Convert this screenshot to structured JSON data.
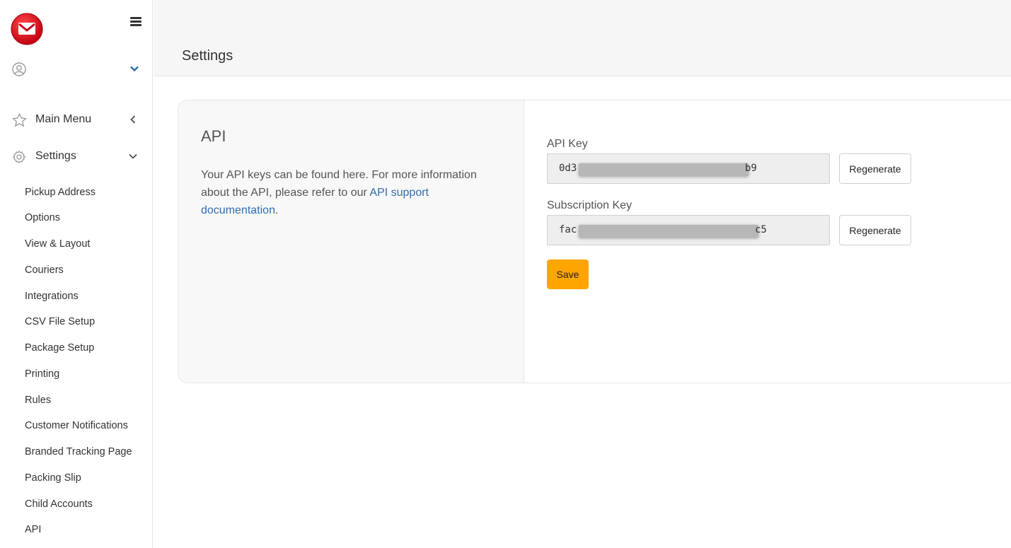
{
  "colors": {
    "accent": "#ffa500",
    "link": "#2f6db3",
    "brand": "#d9001b"
  },
  "sidebar": {
    "logo_icon": "envelope-logo",
    "main_menu_label": "Main Menu",
    "settings_label": "Settings",
    "items": [
      "Pickup Address",
      "Options",
      "View & Layout",
      "Couriers",
      "Integrations",
      "CSV File Setup",
      "Package Setup",
      "Printing",
      "Rules",
      "Customer Notifications",
      "Branded Tracking Page",
      "Packing Slip",
      "Child Accounts",
      "API"
    ]
  },
  "header": {
    "title": "Settings"
  },
  "api_section": {
    "title": "API",
    "description_prefix": "Your API keys can be found here. For more information about the API, please refer to our ",
    "link_text": "API support documentation",
    "description_suffix": ".",
    "api_key_label": "API Key",
    "api_key_start": "0d3",
    "api_key_end": "b9",
    "subscription_key_label": "Subscription Key",
    "subscription_key_start": "fac",
    "subscription_key_end": "c5",
    "regenerate_label": "Regenerate",
    "save_label": "Save"
  }
}
